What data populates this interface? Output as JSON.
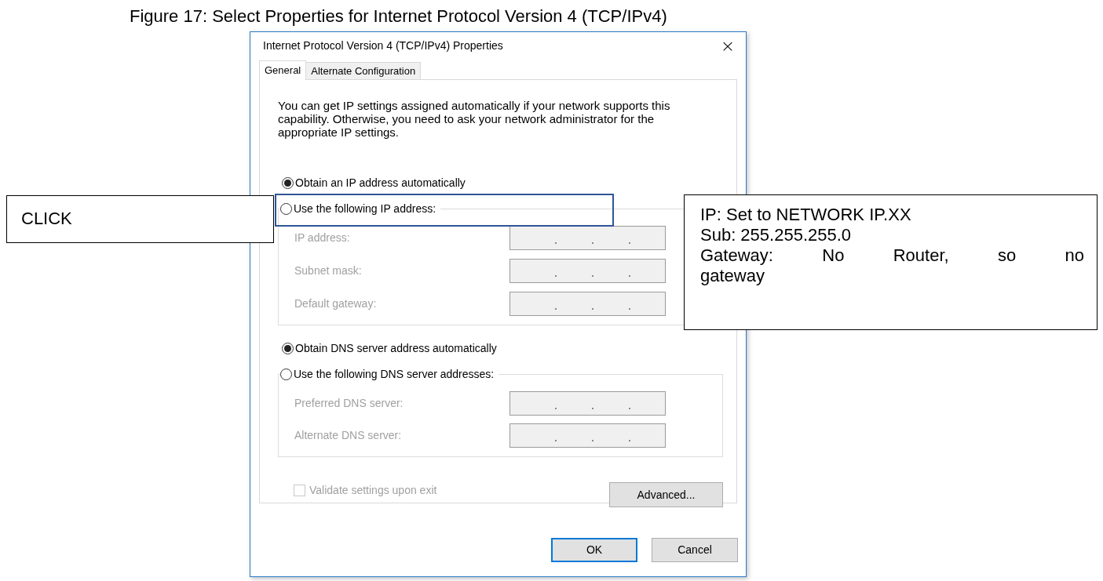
{
  "caption": "Figure 17: Select Properties for Internet Protocol Version 4 (TCP/IPv4)",
  "dialog": {
    "title": "Internet Protocol Version 4 (TCP/IPv4) Properties",
    "close": "×",
    "tabs": [
      {
        "label": "General",
        "selected": true
      },
      {
        "label": "Alternate Configuration",
        "selected": false
      }
    ],
    "description": "You can get IP settings assigned automatically if your network supports this capability. Otherwise, you need to ask your network administrator for the appropriate IP settings.",
    "ip_options": [
      {
        "label": "Obtain an IP address automatically",
        "selected": true
      },
      {
        "label": "Use the following IP address:",
        "selected": false
      }
    ],
    "ip_fields": [
      {
        "label": "IP address:",
        "disabled": true
      },
      {
        "label": "Subnet mask:",
        "disabled": true
      },
      {
        "label": "Default gateway:",
        "disabled": true
      }
    ],
    "dns_options": [
      {
        "label": "Obtain DNS server address automatically",
        "selected": true
      },
      {
        "label": "Use the following DNS server addresses:",
        "selected": false
      }
    ],
    "dns_fields": [
      {
        "label": "Preferred DNS server:",
        "disabled": true
      },
      {
        "label": "Alternate DNS server:",
        "disabled": true
      }
    ],
    "validate": {
      "label": "Validate settings upon exit",
      "checked": false,
      "disabled": true
    },
    "advanced_button": "Advanced...",
    "buttons": [
      {
        "label": "OK",
        "default": true
      },
      {
        "label": "Cancel",
        "default": false
      }
    ]
  },
  "callouts": [
    {
      "lines": [
        "CLICK"
      ]
    },
    {
      "lines": [
        "IP: Set to NETWORK IP.XX",
        "Sub: 255.255.255.0",
        "Gateway: No Router, so no",
        "gateway"
      ]
    }
  ]
}
